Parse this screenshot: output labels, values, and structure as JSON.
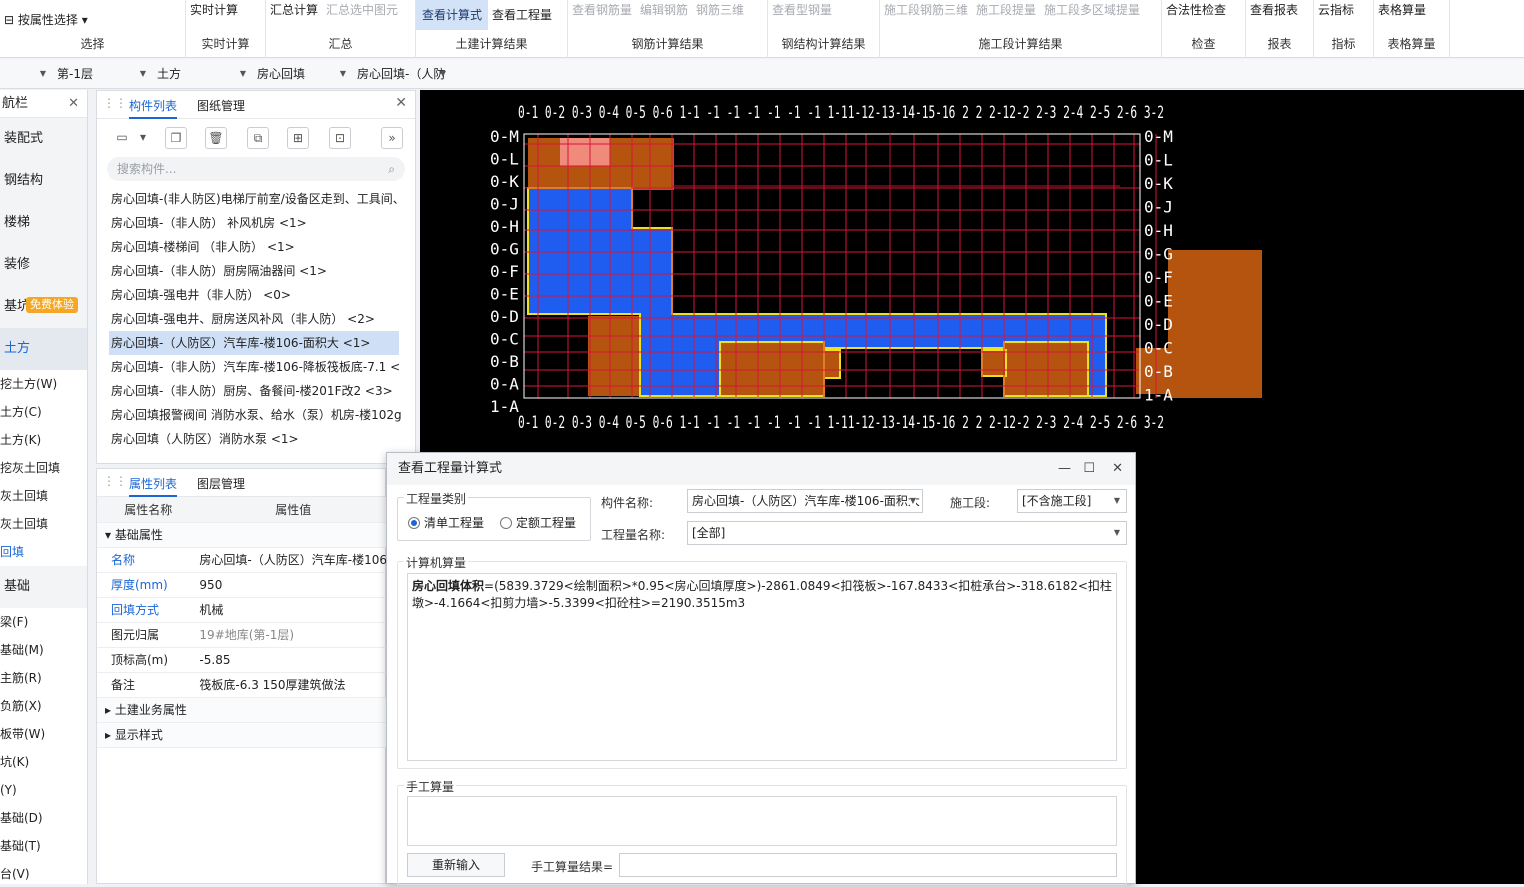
{
  "ribbon": {
    "g0": {
      "b1": "按属性选择",
      "name": "选择"
    },
    "g1": {
      "b1": "实时计算",
      "name": "实时计算"
    },
    "g2": {
      "b1": "汇总计算",
      "b2": "汇总选中图元",
      "name": "汇总"
    },
    "g3": {
      "b1": "查看计算式",
      "b2": "查看工程量",
      "name": "土建计算结果"
    },
    "g4": {
      "b1": "查看钢筋量",
      "b2": "编辑钢筋",
      "b3": "钢筋三维",
      "name": "钢筋计算结果"
    },
    "g5": {
      "b1": "查看型钢量",
      "name": "钢结构计算结果"
    },
    "g6": {
      "b1": "施工段钢筋三维",
      "b2": "施工段提量",
      "b3": "施工段多区域提量",
      "name": "施工段计算结果"
    },
    "g7": {
      "b1": "合法性检查",
      "name": "检查"
    },
    "g8": {
      "b1": "查看报表",
      "name": "报表"
    },
    "g9": {
      "b1": "云指标",
      "name": "指标"
    },
    "g10": {
      "b1": "表格算量",
      "name": "表格算量"
    }
  },
  "toolbar2": {
    "c1": "第-1层",
    "c2": "土方",
    "c3": "房心回填",
    "c4": "房心回填-（人防"
  },
  "leftnav": {
    "header": "航栏",
    "cats": [
      "装配式",
      "钢结构",
      "楼梯",
      "装修",
      "基坑支护",
      "土方"
    ],
    "badge": "免费体验",
    "subs": [
      "挖土方(W)",
      "土方(C)",
      "土方(K)",
      "挖灰土回填",
      "灰土回填",
      "灰土回填",
      "回填"
    ],
    "cat2": "基础",
    "subs2": [
      "梁(F)",
      "基础(M)",
      "主筋(R)",
      "负筋(X)",
      "板带(W)",
      "坑(K)",
      "(Y)",
      "基础(D)",
      "基础(T)",
      "台(V)"
    ]
  },
  "complist": {
    "tab1": "构件列表",
    "tab2": "图纸管理",
    "search_placeholder": "搜索构件...",
    "items": [
      "房心回填-(非人防区)电梯厅前室/设备区走到、工具间、",
      "房心回填-（非人防） 补风机房 <1>",
      "房心回填-楼梯间 （非人防） <1>",
      "房心回填-（非人防）厨房隔油器间 <1>",
      "房心回填-强电井（非人防） <0>",
      "房心回填-强电井、厨房送风补风（非人防） <2>",
      "房心回填-（人防区）汽车库-楼106-面积大 <1>",
      "房心回填-（非人防）汽车库-楼106-降板筏板底-7.1 <",
      "房心回填-（非人防）厨房、备餐间-楼201F改2 <3>",
      "房心回填报警阀间 消防水泵、给水（泵）机房-楼102g",
      "房心回填（人防区）消防水泵 <1>"
    ]
  },
  "props": {
    "tab1": "属性列表",
    "tab2": "图层管理",
    "col1": "属性名称",
    "col2": "属性值",
    "sec1": "基础属性",
    "rows": [
      {
        "k": "名称",
        "v": "房心回填-（人防区）汽车库-楼106"
      },
      {
        "k": "厚度(mm)",
        "v": "950"
      },
      {
        "k": "回填方式",
        "v": "机械"
      },
      {
        "k": "图元归属",
        "v": "19#地库(第-1层)"
      },
      {
        "k": "顶标高(m)",
        "v": "-5.85"
      },
      {
        "k": "备注",
        "v": "筏板底-6.3 150厚建筑做法"
      }
    ],
    "sec2": "土建业务属性",
    "sec3": "显示样式"
  },
  "dialog": {
    "title": "查看工程量计算式",
    "cat_legend": "工程量类别",
    "radio1": "清单工程量",
    "radio2": "定额工程量",
    "comp_label": "构件名称:",
    "comp_value": "房心回填-（人防区）汽车库-楼106-面积大",
    "seg_label": "施工段:",
    "seg_value": "[不含施工段]",
    "qty_label": "工程量名称:",
    "qty_value": "[全部]",
    "calc_legend": "计算机算量",
    "formula_bold": "房心回填体积",
    "formula_rest": "=(5839.3729<绘制面积>*0.95<房心回填厚度>)-2861.0849<扣筏板>-167.8433<扣桩承台>-318.6182<扣柱墩>-4.1664<扣剪力墙>-5.3399<扣砼柱>=2190.3515m3",
    "manual_legend": "手工算量",
    "reinput": "重新输入",
    "manual_result_label": "手工算量结果="
  },
  "drawing": {
    "top_axis": "0-1 0-2 0-3 0-4 0-5 0-6 1-1 -1 -1 -1 -1 -1 -1 1-11-12-13-14-15-16 2 2 2-12-2 2-3 2-4 2-5 2-6 3-2",
    "bottom_axis": "0-1 0-2 0-3 0-4 0-5 0-6 1-1 -1 -1 -1 -1 -1 -1 1-11-12-13-14-15-16 2 2 2-12-2 2-3 2-4 2-5 2-6 3-2",
    "left_axis": [
      "0-M",
      "0-L",
      "0-K",
      "0-J",
      "0-H",
      "0-G",
      "0-F",
      "0-E",
      "0-D",
      "0-C",
      "0-B",
      "0-A",
      "1-A"
    ],
    "right_axis": [
      "0-M",
      "0-L",
      "0-K",
      "0-J",
      "0-H",
      "0-G",
      "0-F",
      "0-E",
      "0-D",
      "0-C",
      "0-B",
      "1-A"
    ],
    "fill_blue": "#1f5cf0",
    "fill_brown": "#b5540e",
    "grid_red": "#d6163a",
    "outline_yellow": "#f0e020"
  }
}
